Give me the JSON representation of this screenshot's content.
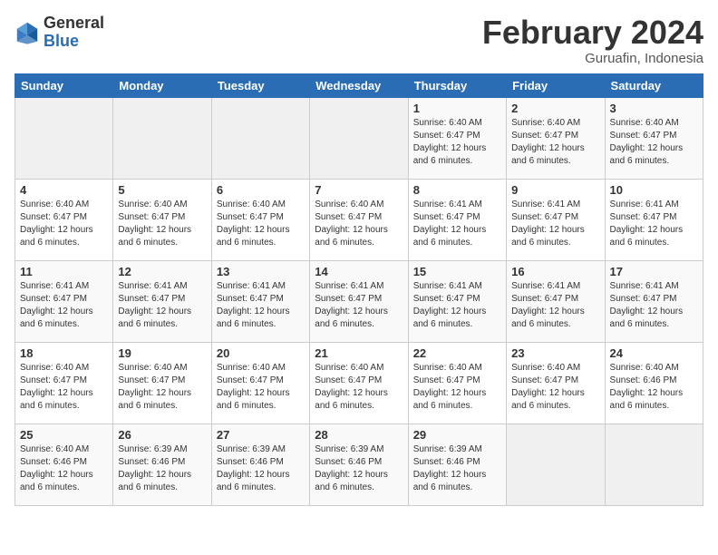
{
  "logo": {
    "general": "General",
    "blue": "Blue"
  },
  "header": {
    "month": "February 2024",
    "location": "Guruafin, Indonesia"
  },
  "weekdays": [
    "Sunday",
    "Monday",
    "Tuesday",
    "Wednesday",
    "Thursday",
    "Friday",
    "Saturday"
  ],
  "weeks": [
    [
      {
        "day": "",
        "sunrise": "",
        "sunset": "",
        "daylight": ""
      },
      {
        "day": "",
        "sunrise": "",
        "sunset": "",
        "daylight": ""
      },
      {
        "day": "",
        "sunrise": "",
        "sunset": "",
        "daylight": ""
      },
      {
        "day": "",
        "sunrise": "",
        "sunset": "",
        "daylight": ""
      },
      {
        "day": "1",
        "sunrise": "Sunrise: 6:40 AM",
        "sunset": "Sunset: 6:47 PM",
        "daylight": "Daylight: 12 hours and 6 minutes."
      },
      {
        "day": "2",
        "sunrise": "Sunrise: 6:40 AM",
        "sunset": "Sunset: 6:47 PM",
        "daylight": "Daylight: 12 hours and 6 minutes."
      },
      {
        "day": "3",
        "sunrise": "Sunrise: 6:40 AM",
        "sunset": "Sunset: 6:47 PM",
        "daylight": "Daylight: 12 hours and 6 minutes."
      }
    ],
    [
      {
        "day": "4",
        "sunrise": "Sunrise: 6:40 AM",
        "sunset": "Sunset: 6:47 PM",
        "daylight": "Daylight: 12 hours and 6 minutes."
      },
      {
        "day": "5",
        "sunrise": "Sunrise: 6:40 AM",
        "sunset": "Sunset: 6:47 PM",
        "daylight": "Daylight: 12 hours and 6 minutes."
      },
      {
        "day": "6",
        "sunrise": "Sunrise: 6:40 AM",
        "sunset": "Sunset: 6:47 PM",
        "daylight": "Daylight: 12 hours and 6 minutes."
      },
      {
        "day": "7",
        "sunrise": "Sunrise: 6:40 AM",
        "sunset": "Sunset: 6:47 PM",
        "daylight": "Daylight: 12 hours and 6 minutes."
      },
      {
        "day": "8",
        "sunrise": "Sunrise: 6:41 AM",
        "sunset": "Sunset: 6:47 PM",
        "daylight": "Daylight: 12 hours and 6 minutes."
      },
      {
        "day": "9",
        "sunrise": "Sunrise: 6:41 AM",
        "sunset": "Sunset: 6:47 PM",
        "daylight": "Daylight: 12 hours and 6 minutes."
      },
      {
        "day": "10",
        "sunrise": "Sunrise: 6:41 AM",
        "sunset": "Sunset: 6:47 PM",
        "daylight": "Daylight: 12 hours and 6 minutes."
      }
    ],
    [
      {
        "day": "11",
        "sunrise": "Sunrise: 6:41 AM",
        "sunset": "Sunset: 6:47 PM",
        "daylight": "Daylight: 12 hours and 6 minutes."
      },
      {
        "day": "12",
        "sunrise": "Sunrise: 6:41 AM",
        "sunset": "Sunset: 6:47 PM",
        "daylight": "Daylight: 12 hours and 6 minutes."
      },
      {
        "day": "13",
        "sunrise": "Sunrise: 6:41 AM",
        "sunset": "Sunset: 6:47 PM",
        "daylight": "Daylight: 12 hours and 6 minutes."
      },
      {
        "day": "14",
        "sunrise": "Sunrise: 6:41 AM",
        "sunset": "Sunset: 6:47 PM",
        "daylight": "Daylight: 12 hours and 6 minutes."
      },
      {
        "day": "15",
        "sunrise": "Sunrise: 6:41 AM",
        "sunset": "Sunset: 6:47 PM",
        "daylight": "Daylight: 12 hours and 6 minutes."
      },
      {
        "day": "16",
        "sunrise": "Sunrise: 6:41 AM",
        "sunset": "Sunset: 6:47 PM",
        "daylight": "Daylight: 12 hours and 6 minutes."
      },
      {
        "day": "17",
        "sunrise": "Sunrise: 6:41 AM",
        "sunset": "Sunset: 6:47 PM",
        "daylight": "Daylight: 12 hours and 6 minutes."
      }
    ],
    [
      {
        "day": "18",
        "sunrise": "Sunrise: 6:40 AM",
        "sunset": "Sunset: 6:47 PM",
        "daylight": "Daylight: 12 hours and 6 minutes."
      },
      {
        "day": "19",
        "sunrise": "Sunrise: 6:40 AM",
        "sunset": "Sunset: 6:47 PM",
        "daylight": "Daylight: 12 hours and 6 minutes."
      },
      {
        "day": "20",
        "sunrise": "Sunrise: 6:40 AM",
        "sunset": "Sunset: 6:47 PM",
        "daylight": "Daylight: 12 hours and 6 minutes."
      },
      {
        "day": "21",
        "sunrise": "Sunrise: 6:40 AM",
        "sunset": "Sunset: 6:47 PM",
        "daylight": "Daylight: 12 hours and 6 minutes."
      },
      {
        "day": "22",
        "sunrise": "Sunrise: 6:40 AM",
        "sunset": "Sunset: 6:47 PM",
        "daylight": "Daylight: 12 hours and 6 minutes."
      },
      {
        "day": "23",
        "sunrise": "Sunrise: 6:40 AM",
        "sunset": "Sunset: 6:47 PM",
        "daylight": "Daylight: 12 hours and 6 minutes."
      },
      {
        "day": "24",
        "sunrise": "Sunrise: 6:40 AM",
        "sunset": "Sunset: 6:46 PM",
        "daylight": "Daylight: 12 hours and 6 minutes."
      }
    ],
    [
      {
        "day": "25",
        "sunrise": "Sunrise: 6:40 AM",
        "sunset": "Sunset: 6:46 PM",
        "daylight": "Daylight: 12 hours and 6 minutes."
      },
      {
        "day": "26",
        "sunrise": "Sunrise: 6:39 AM",
        "sunset": "Sunset: 6:46 PM",
        "daylight": "Daylight: 12 hours and 6 minutes."
      },
      {
        "day": "27",
        "sunrise": "Sunrise: 6:39 AM",
        "sunset": "Sunset: 6:46 PM",
        "daylight": "Daylight: 12 hours and 6 minutes."
      },
      {
        "day": "28",
        "sunrise": "Sunrise: 6:39 AM",
        "sunset": "Sunset: 6:46 PM",
        "daylight": "Daylight: 12 hours and 6 minutes."
      },
      {
        "day": "29",
        "sunrise": "Sunrise: 6:39 AM",
        "sunset": "Sunset: 6:46 PM",
        "daylight": "Daylight: 12 hours and 6 minutes."
      },
      {
        "day": "",
        "sunrise": "",
        "sunset": "",
        "daylight": ""
      },
      {
        "day": "",
        "sunrise": "",
        "sunset": "",
        "daylight": ""
      }
    ]
  ]
}
